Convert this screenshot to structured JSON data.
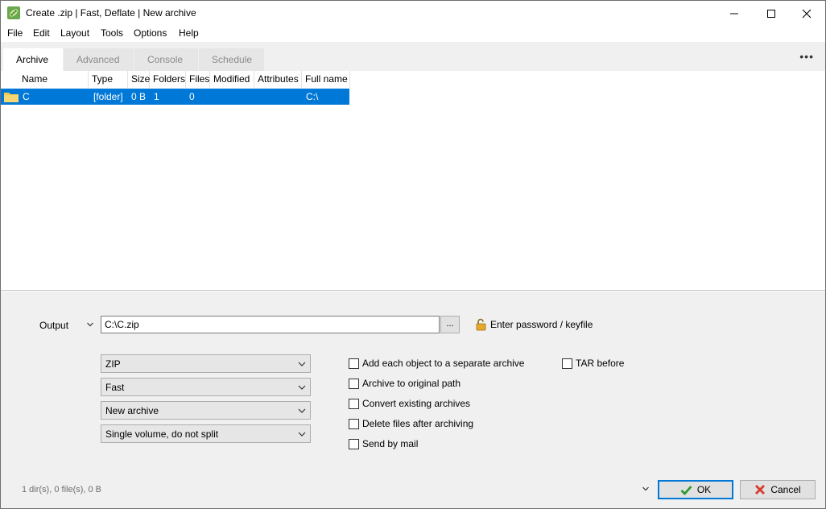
{
  "window": {
    "title": "Create .zip | Fast, Deflate | New archive",
    "minimize_icon": "minimize-icon",
    "maximize_icon": "maximize-icon",
    "close_icon": "close-icon"
  },
  "menu": [
    "File",
    "Edit",
    "Layout",
    "Tools",
    "Options",
    "Help"
  ],
  "tabs": [
    {
      "label": "Archive",
      "active": true
    },
    {
      "label": "Advanced",
      "active": false
    },
    {
      "label": "Console",
      "active": false
    },
    {
      "label": "Schedule",
      "active": false
    }
  ],
  "more_label": "•••",
  "file_list": {
    "columns": [
      "Name",
      "Type",
      "Size",
      "Folders",
      "Files",
      "Modified",
      "Attributes",
      "Full name"
    ],
    "rows": [
      {
        "name": "C",
        "type": "[folder]",
        "size": "0 B",
        "folders": "1",
        "files": "0",
        "modified": "",
        "attributes": "",
        "full_name": "C:\\",
        "selected": true
      }
    ]
  },
  "output": {
    "label": "Output",
    "value": "C:\\C.zip",
    "browse_label": "...",
    "password_label": "Enter password / keyfile"
  },
  "options": {
    "format": "ZIP",
    "compression": "Fast",
    "mode": "New archive",
    "split": "Single volume, do not split"
  },
  "checkboxes": {
    "separate": {
      "label": "Add each object to a separate archive",
      "checked": false
    },
    "original_path": {
      "label": "Archive to original path",
      "checked": false
    },
    "convert": {
      "label": "Convert existing archives",
      "checked": false
    },
    "delete": {
      "label": "Delete files after archiving",
      "checked": false
    },
    "mail": {
      "label": "Send by mail",
      "checked": false
    },
    "tar": {
      "label": "TAR before",
      "checked": false
    }
  },
  "status": "1 dir(s), 0 file(s), 0 B",
  "buttons": {
    "ok": "OK",
    "cancel": "Cancel"
  },
  "colors": {
    "selection": "#0078d7",
    "ok_check": "#2e9b2e",
    "cancel_x": "#d83b2e",
    "folder": "#f3c94e"
  }
}
